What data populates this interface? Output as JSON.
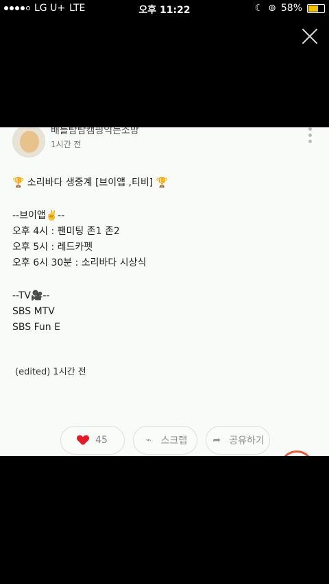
{
  "status_bar": {
    "carrier": "LG U+",
    "network": "LTE",
    "time": "오후 11:22",
    "battery_percent": "58%",
    "battery_level": 0.58
  },
  "viewer": {
    "close_icon": "close-icon"
  },
  "post": {
    "author": "배를탐탐캠핑익는소망",
    "time_ago": "1시간 전",
    "lines": [
      "🏆 소리바다 생중계 [브이앱 ,티비] 🏆",
      "",
      "--브이앱✌️--",
      "오후 4시 : 팬미팅 존1 존2",
      "오후 5시 : 레드카펫",
      "오후 6시 30분 : 소리바다 시상식",
      "",
      "--TV🎥--",
      "SBS MTV",
      "SBS Fun E"
    ],
    "edited": "(edited) 1시간 전"
  },
  "actions": {
    "like_count": "45",
    "scrap_label": "스크랩",
    "share_label": "공유하기"
  },
  "colors": {
    "like": "#e11d2a",
    "battery": "#f3c300",
    "accent": "#e85a3d"
  }
}
